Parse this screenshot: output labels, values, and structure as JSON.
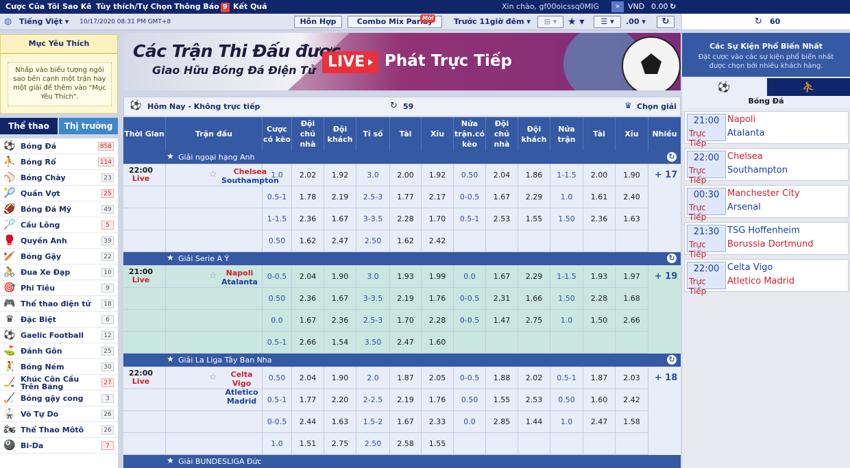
{
  "topnav": {
    "items": [
      "Cược Của Tôi",
      "Sao Kê",
      "Tùy thích/Tự Chọn",
      "Thông Báo",
      "Kết Quả"
    ],
    "notif_count": "9",
    "greeting": "Xin chào, gf00oicssq0MIG",
    "currency": "VND",
    "balance": "0.00"
  },
  "bar2": {
    "language": "Tiếng Việt",
    "datetime": "10/17/2020 08:31 PM GMT+8",
    "mixed_btn": "Hỗn Hợp",
    "combo_btn": "Combo Mix Parlay",
    "new_badge": "Mới",
    "time_filter": "Trước 11giờ đêm",
    "odds_format": ".00"
  },
  "right_header": {
    "count": "60"
  },
  "favorites": {
    "title": "Mục Yêu Thích",
    "hint": "Nhấp vào biểu tượng ngôi sao bên cạnh một trận hay một giải để thêm vào \"Mục Yêu Thích\"."
  },
  "left_tabs": {
    "sports": "Thể thao",
    "market": "Thị trường"
  },
  "sports": [
    {
      "name": "Bóng Đá",
      "count": "858",
      "hot": true,
      "icon": "soccer-icon"
    },
    {
      "name": "Bóng Rổ",
      "count": "114",
      "hot": true,
      "icon": "basketball-icon"
    },
    {
      "name": "Bóng Chày",
      "count": "23",
      "hot": false,
      "icon": "baseball-icon"
    },
    {
      "name": "Quần Vợt",
      "count": "25",
      "hot": true,
      "icon": "tennis-icon"
    },
    {
      "name": "Bóng Đá Mỹ",
      "count": "49",
      "hot": false,
      "icon": "american-football-icon"
    },
    {
      "name": "Cầu Lông",
      "count": "5",
      "hot": true,
      "icon": "badminton-icon"
    },
    {
      "name": "Quyền Anh",
      "count": "39",
      "hot": false,
      "icon": "boxing-icon"
    },
    {
      "name": "Bóng Gậy",
      "count": "22",
      "hot": false,
      "icon": "cricket-icon"
    },
    {
      "name": "Đua Xe Đạp",
      "count": "10",
      "hot": false,
      "icon": "cycling-icon"
    },
    {
      "name": "Phi Tiêu",
      "count": "9",
      "hot": false,
      "icon": "darts-icon"
    },
    {
      "name": "Thể thao điện tử",
      "count": "18",
      "hot": false,
      "icon": "esports-icon"
    },
    {
      "name": "Đặc Biệt",
      "count": "6",
      "hot": false,
      "icon": "crown-icon"
    },
    {
      "name": "Gaelic Football",
      "count": "12",
      "hot": false,
      "icon": "gaelic-football-icon"
    },
    {
      "name": "Đánh Gôn",
      "count": "25",
      "hot": false,
      "icon": "golf-icon"
    },
    {
      "name": "Bóng Ném",
      "count": "30",
      "hot": false,
      "icon": "handball-icon"
    },
    {
      "name": "Khúc Côn Cầu Trên Băng",
      "count": "27",
      "hot": true,
      "icon": "ice-hockey-icon"
    },
    {
      "name": "Bóng gậy cong",
      "count": "3",
      "hot": false,
      "icon": "hurling-icon"
    },
    {
      "name": "Võ Tự Do",
      "count": "26",
      "hot": false,
      "icon": "mma-icon"
    },
    {
      "name": "Thể Thao Môtô",
      "count": "26",
      "hot": false,
      "icon": "motorsport-icon"
    },
    {
      "name": "Bi-Da",
      "count": "7",
      "hot": true,
      "icon": "billiards-icon"
    }
  ],
  "banner": {
    "line1": "Các Trận Thi Đấu được",
    "line2": "Giao Hữu Bóng Đá Điện Tử",
    "live": "LIVE",
    "line3": "Phát Trực Tiếp"
  },
  "subheader": {
    "title": "Hôm Nay - Không trực tiếp",
    "count": "59",
    "choose_league": "Chọn giải"
  },
  "columns": [
    "Thời Gian",
    "Trận đấu",
    "Cược có kèo",
    "Đội chủ nhà",
    "Đội khách",
    "Tỉ số",
    "Tài",
    "Xỉu",
    "Nửa trận.có kèo",
    "Đội chủ nhà",
    "Đội khách",
    "Nửa trận",
    "Tài",
    "Xỉu",
    "Nhiều"
  ],
  "leagues": [
    {
      "name": "Giải ngoại hạng Anh",
      "bg": "#e8eef9",
      "time": "22:00",
      "status": "Live",
      "home": "Chelsea",
      "away": "Southampton",
      "more": "+ 17",
      "rows": [
        [
          "1.0",
          "2.02",
          "1.92",
          "3.0",
          "2.00",
          "1.92",
          "0.50",
          "2.04",
          "1.86",
          "1-1.5",
          "2.00",
          "1.90"
        ],
        [
          "0.5-1",
          "1.78",
          "2.19",
          "2.5-3",
          "1.77",
          "2.17",
          "0-0.5",
          "1.67",
          "2.29",
          "1.0",
          "1.61",
          "2.40"
        ],
        [
          "1-1.5",
          "2.36",
          "1.67",
          "3-3.5",
          "2.28",
          "1.70",
          "0.5-1",
          "2.53",
          "1.55",
          "1.50",
          "2.36",
          "1.63"
        ],
        [
          "0.50",
          "1.62",
          "2.47",
          "2.50",
          "1.62",
          "2.42",
          "",
          "",
          "",
          "",
          "",
          ""
        ]
      ]
    },
    {
      "name": "Giải Serie A Ý",
      "bg": "#c9e7e0",
      "time": "21:00",
      "status": "Live",
      "home": "Napoli",
      "away": "Atalanta",
      "more": "+ 19",
      "rows": [
        [
          "0-0.5",
          "2.04",
          "1.90",
          "3.0",
          "1.93",
          "1.99",
          "0.0",
          "1.67",
          "2.29",
          "1-1.5",
          "1.93",
          "1.97"
        ],
        [
          "0.50",
          "2.36",
          "1.67",
          "3-3.5",
          "2.19",
          "1.76",
          "0-0.5",
          "2.31",
          "1.66",
          "1.50",
          "2.28",
          "1.68"
        ],
        [
          "0.0",
          "1.67",
          "2.36",
          "2.5-3",
          "1.70",
          "2.28",
          "0-0.5",
          "1.47",
          "2.75",
          "1.0",
          "1.50",
          "2.66"
        ],
        [
          "0.5-1",
          "2.66",
          "1.54",
          "3.50",
          "2.47",
          "1.60",
          "",
          "",
          "",
          "",
          "",
          ""
        ]
      ]
    },
    {
      "name": "Giải La Liga Tây Ban Nha",
      "bg": "#e8eef9",
      "time": "22:00",
      "status": "Live",
      "home": "Celta Vigo",
      "away": "Atletico Madrid",
      "more": "+ 18",
      "rows": [
        [
          "0.50",
          "2.04",
          "1.90",
          "2.0",
          "1.87",
          "2.05",
          "0-0.5",
          "1.88",
          "2.02",
          "0.5-1",
          "1.87",
          "2.03"
        ],
        [
          "0.5-1",
          "1.77",
          "2.20",
          "2-2.5",
          "2.19",
          "1.76",
          "0.50",
          "1.55",
          "2.53",
          "0.50",
          "1.60",
          "2.42"
        ],
        [
          "0-0.5",
          "2.44",
          "1.63",
          "1.5-2",
          "1.67",
          "2.33",
          "0.0",
          "2.85",
          "1.44",
          "1.0",
          "2.47",
          "1.58"
        ],
        [
          "1.0",
          "1.51",
          "2.75",
          "2.50",
          "2.58",
          "1.55",
          "",
          "",
          "",
          "",
          "",
          ""
        ]
      ]
    }
  ],
  "next_league": "Giải BUNDESLIGA Đức",
  "popular": {
    "title": "Các Sự Kiện Phổ Biến Nhất",
    "desc": "Đặt cược vào các sự kiện phổ biến nhất được chọn bởi nhiều khách hàng.",
    "sport_label": "Bóng Đá",
    "events": [
      {
        "time": "21:00",
        "status": "Trực Tiếp",
        "home": "Napoli",
        "away": "Atalanta",
        "home_red": true
      },
      {
        "time": "22:00",
        "status": "Trực Tiếp",
        "home": "Chelsea",
        "away": "Southampton",
        "home_red": true
      },
      {
        "time": "00:30",
        "status": "Trực Tiếp",
        "home": "Manchester City",
        "away": "Arsenal",
        "home_red": true
      },
      {
        "time": "21:30",
        "status": "Trực Tiếp",
        "home": "TSG Hoffenheim",
        "away": "Borussia Dortmund",
        "home_red": false
      },
      {
        "time": "22:00",
        "status": "Trực Tiếp",
        "home": "Celta Vigo",
        "away": "Atletico Madrid",
        "home_red": false
      }
    ]
  }
}
